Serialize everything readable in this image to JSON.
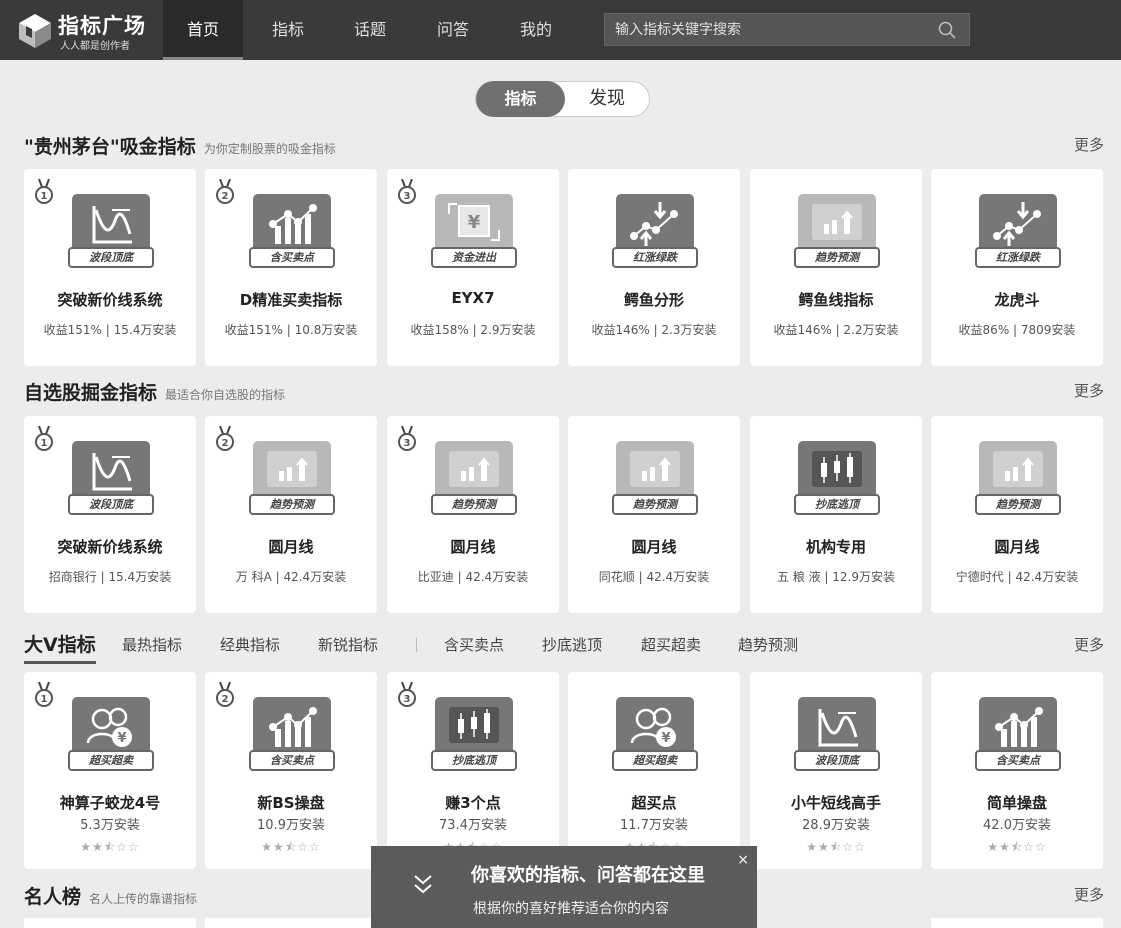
{
  "header": {
    "logo_title": "指标广场",
    "logo_sub": "人人都是创作者",
    "nav": [
      "首页",
      "指标",
      "话题",
      "问答",
      "我的"
    ],
    "search_placeholder": "输入指标关键字搜索"
  },
  "toggle": {
    "active": "指标",
    "inactive": "发现"
  },
  "section1": {
    "title": "\"贵州茅台\"吸金指标",
    "subtitle": "为你定制股票的吸金指标",
    "more": "更多",
    "cards": [
      {
        "name": "突破新价线系统",
        "meta": "收益151% | 15.4万安装",
        "tag": "波段顶底",
        "icon": "wave-top-bottom-icon",
        "medal": "1"
      },
      {
        "name": "D精准买卖指标",
        "meta": "收益151% | 10.8万安装",
        "tag": "含买卖点",
        "icon": "buy-sell-points-icon",
        "medal": "2"
      },
      {
        "name": "EYX7",
        "meta": "收益158% | 2.9万安装",
        "tag": "资金进出",
        "icon": "money-flow-icon",
        "medal": "3"
      },
      {
        "name": "鳄鱼分形",
        "meta": "收益146% | 2.3万安装",
        "tag": "红涨绿跌",
        "icon": "rise-fall-icon",
        "medal": ""
      },
      {
        "name": "鳄鱼线指标",
        "meta": "收益146% | 2.2万安装",
        "tag": "趋势预测",
        "icon": "trend-forecast-icon",
        "medal": ""
      },
      {
        "name": "龙虎斗",
        "meta": "收益86% | 7809安装",
        "tag": "红涨绿跌",
        "icon": "rise-fall-icon",
        "medal": ""
      }
    ]
  },
  "section2": {
    "title": "自选股掘金指标",
    "subtitle": "最适合你自选股的指标",
    "more": "更多",
    "cards": [
      {
        "name": "突破新价线系统",
        "meta": "招商银行 | 15.4万安装",
        "tag": "波段顶底",
        "icon": "wave-top-bottom-icon",
        "medal": "1"
      },
      {
        "name": "圆月线",
        "meta": "万 科A | 42.4万安装",
        "tag": "趋势预测",
        "icon": "trend-forecast-icon",
        "medal": "2"
      },
      {
        "name": "圆月线",
        "meta": "比亚迪 | 42.4万安装",
        "tag": "趋势预测",
        "icon": "trend-forecast-icon",
        "medal": "3"
      },
      {
        "name": "圆月线",
        "meta": "同花顺 | 42.4万安装",
        "tag": "趋势预测",
        "icon": "trend-forecast-icon",
        "medal": ""
      },
      {
        "name": "机构专用",
        "meta": "五 粮 液 | 12.9万安装",
        "tag": "抄底逃顶",
        "icon": "candlestick-icon",
        "medal": ""
      },
      {
        "name": "圆月线",
        "meta": "宁德时代 | 42.4万安装",
        "tag": "趋势预测",
        "icon": "trend-forecast-icon",
        "medal": ""
      }
    ]
  },
  "section3": {
    "main_tab": "大V指标",
    "tabs_left": [
      "最热指标",
      "经典指标",
      "新锐指标"
    ],
    "tabs_right": [
      "含买卖点",
      "抄底逃顶",
      "超买超卖",
      "趋势预测"
    ],
    "more": "更多",
    "cards": [
      {
        "name": "神算子蛟龙4号",
        "installs": "5.3万安装",
        "rating": 2.5,
        "tag": "超买超卖",
        "icon": "overbought-oversold-icon",
        "medal": "1"
      },
      {
        "name": "新BS操盘",
        "installs": "10.9万安装",
        "rating": 2.5,
        "tag": "含买卖点",
        "icon": "buy-sell-points-icon",
        "medal": "2"
      },
      {
        "name": "赚3个点",
        "installs": "73.4万安装",
        "rating": 2.5,
        "tag": "抄底逃顶",
        "icon": "candlestick-icon",
        "medal": "3"
      },
      {
        "name": "超买点",
        "installs": "11.7万安装",
        "rating": 2.5,
        "tag": "超买超卖",
        "icon": "overbought-oversold-icon",
        "medal": ""
      },
      {
        "name": "小牛短线高手",
        "installs": "28.9万安装",
        "rating": 2.5,
        "tag": "波段顶底",
        "icon": "wave-top-bottom-icon",
        "medal": ""
      },
      {
        "name": "简单操盘",
        "installs": "42.0万安装",
        "rating": 2.5,
        "tag": "含买卖点",
        "icon": "buy-sell-points-icon",
        "medal": ""
      }
    ]
  },
  "section4": {
    "title": "名人榜",
    "subtitle": "名人上传的靠谱指标",
    "more": "更多"
  },
  "popup": {
    "title": "你喜欢的指标、问答都在这里",
    "subtitle": "根据你的喜好推荐适合你的内容",
    "close": "×"
  }
}
